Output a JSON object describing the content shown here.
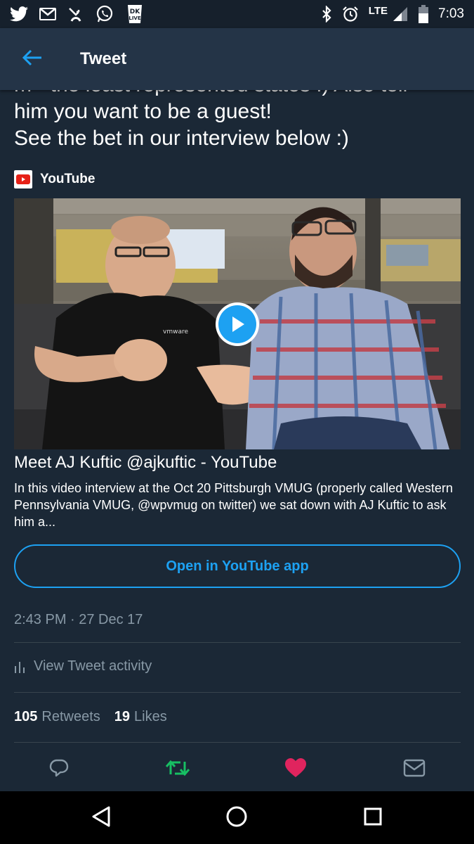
{
  "status_bar": {
    "time": "7:03",
    "network": "LTE",
    "left_icons": [
      "twitter-icon",
      "gmail-icon",
      "missed-call-icon",
      "whatsapp-icon",
      "dk-live-icon"
    ],
    "dk_live_text": "DK LIVE",
    "right_icons": [
      "bluetooth-icon",
      "alarm-icon",
      "signal-icon",
      "battery-icon"
    ]
  },
  "header": {
    "title": "Tweet",
    "back_icon": "back-arrow-icon"
  },
  "tweet": {
    "text_line_1": "m - the least represented states :) Also tell",
    "text_line_2": "him you want to be a guest!",
    "text_line_3": "See the bet in our interview below :)"
  },
  "card": {
    "source": "YouTube",
    "title": "Meet AJ Kuftic @ajkuftic - YouTube",
    "description": "In this video interview at the Oct 20 Pittsburgh VMUG (properly called Western Pennsylvania VMUG, @wpvmug on twitter) we sat down with AJ Kuftic to ask him a...",
    "open_button": "Open in YouTube app",
    "shirt_text": "vmware"
  },
  "meta": {
    "timestamp": "2:43 PM · 27 Dec 17",
    "activity_label": "View Tweet activity",
    "retweets_count": "105",
    "retweets_label": "Retweets",
    "likes_count": "19",
    "likes_label": "Likes"
  },
  "actions": [
    "reply-icon",
    "retweet-icon",
    "like-icon",
    "message-icon"
  ],
  "colors": {
    "background": "#1b2836",
    "header": "#243447",
    "accent": "#1da1f2",
    "muted": "#8899a6",
    "retweet_active": "#17bf63",
    "like_active": "#e0245e"
  },
  "navbar": [
    "nav-back-icon",
    "nav-home-icon",
    "nav-recents-icon"
  ]
}
